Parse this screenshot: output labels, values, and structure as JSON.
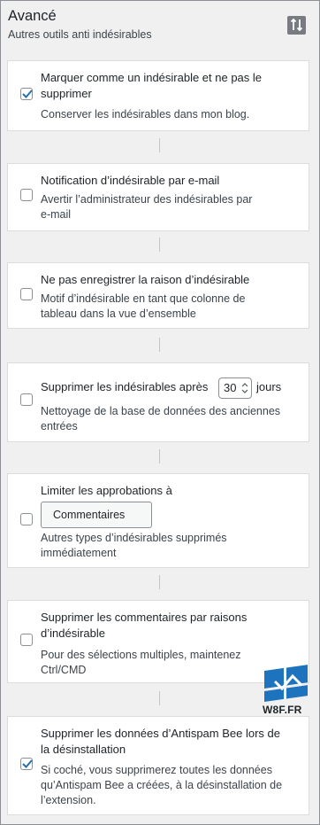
{
  "header": {
    "title": "Avancé",
    "subtitle": "Autres outils anti indésirables",
    "sort_icon": "sort-arrows-icon"
  },
  "options": [
    {
      "label": "Marquer comme un indésirable et ne pas le supprimer",
      "label_lines": [
        "Marquer comme un indésirable et ne pas le",
        "supprimer"
      ],
      "description_lines": [
        "Conserver les indésirables dans mon blog."
      ],
      "checked": true
    },
    {
      "label_lines": [
        "Notification d’indésirable par e-mail"
      ],
      "description_lines": [
        "Avertir l’administrateur des indésirables par",
        "e-mail"
      ],
      "checked": false
    },
    {
      "label_lines": [
        "Ne pas enregistrer la raison d’indésirable"
      ],
      "description_lines": [
        "Motif d’indésirable en tant que colonne de",
        "tableau dans la vue d’ensemble"
      ],
      "checked": false
    },
    {
      "label_before": "Supprimer les indésirables après",
      "days_value": "30",
      "label_after": "jours",
      "description_lines": [
        "Nettoyage de la base de données des anciennes",
        "entrées"
      ],
      "checked": false
    },
    {
      "label_lines": [
        "Limiter les approbations à"
      ],
      "select_value": "Commentaires",
      "description_lines": [
        "Autres types d’indésirables supprimés",
        "immédiatement"
      ],
      "checked": false
    },
    {
      "label_lines": [
        "Supprimer les commentaires par raisons",
        "d’indésirable"
      ],
      "description_lines": [
        "Pour des sélections multiples, maintenez",
        "Ctrl/CMD"
      ],
      "checked": false
    },
    {
      "label_lines": [
        "Supprimer les données d’Antispam Bee lors de",
        "la désinstallation"
      ],
      "description_lines": [
        "Si coché, vous supprimerez toutes les données",
        "qu’Antispam Bee a créées, à la désinstallation de",
        "l’extension."
      ],
      "checked": true
    }
  ],
  "watermark": {
    "text": "W8F.FR",
    "icon": "windows-logo-watermark-icon"
  },
  "colors": {
    "background": "#f0f0f1",
    "card": "#ffffff",
    "checkbox_check": "#2271b1",
    "watermark_blue": "#1e73be"
  }
}
